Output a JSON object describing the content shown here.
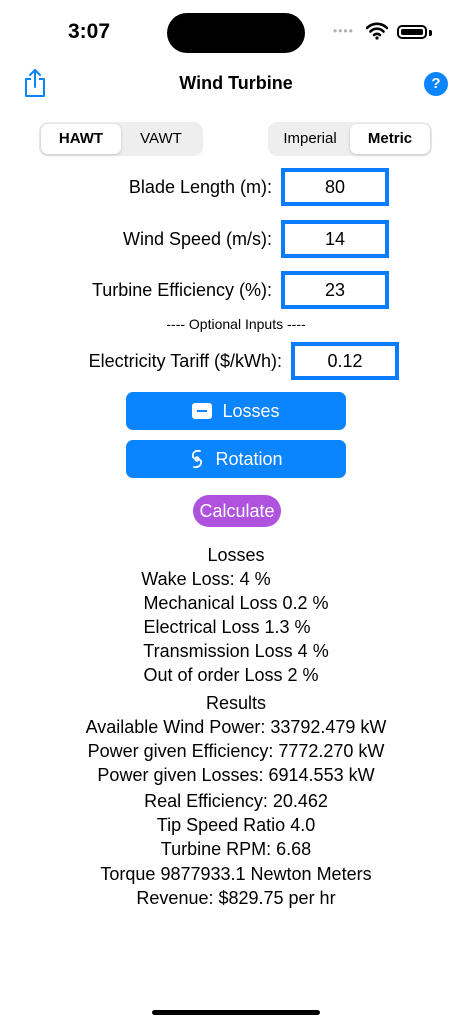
{
  "status_bar": {
    "time": "3:07",
    "signal": "••••"
  },
  "nav": {
    "title": "Wind Turbine",
    "help_symbol": "?"
  },
  "type_segment": {
    "options": [
      "HAWT",
      "VAWT"
    ],
    "selected": "HAWT"
  },
  "unit_segment": {
    "options": [
      "Imperial",
      "Metric"
    ],
    "selected": "Metric"
  },
  "inputs": {
    "blade_length": {
      "label": "Blade Length (m):",
      "value": "80"
    },
    "wind_speed": {
      "label": "Wind Speed (m/s):",
      "value": "14"
    },
    "efficiency": {
      "label": "Turbine Efficiency (%):",
      "value": "23"
    }
  },
  "optional_label": "---- Optional Inputs ----",
  "tariff": {
    "label": "Electricity Tariff ($/kWh):",
    "value": "0.12"
  },
  "buttons": {
    "losses": "Losses",
    "rotation": "Rotation",
    "calculate": "Calculate"
  },
  "losses_section": {
    "heading": "Losses",
    "lines": [
      "Wake Loss: 4 %",
      "Mechanical Loss 0.2 %",
      "Electrical Loss 1.3 %",
      "Transmission Loss 4 %",
      "Out of order Loss 2 %"
    ]
  },
  "results_section": {
    "heading": "Results",
    "lines": [
      "Available Wind Power: 33792.479 kW",
      "Power given Efficiency: 7772.270 kW",
      "Power given Losses: 6914.553 kW",
      "Real Efficiency: 20.462",
      "Tip Speed Ratio 4.0",
      "Turbine RPM: 6.68",
      "Torque 9877933.1 Newton Meters",
      "Revenue: $829.75 per hr"
    ]
  },
  "colors": {
    "accent": "#0a84ff",
    "field_border": "#0a7cff",
    "calculate": "#af52de"
  }
}
